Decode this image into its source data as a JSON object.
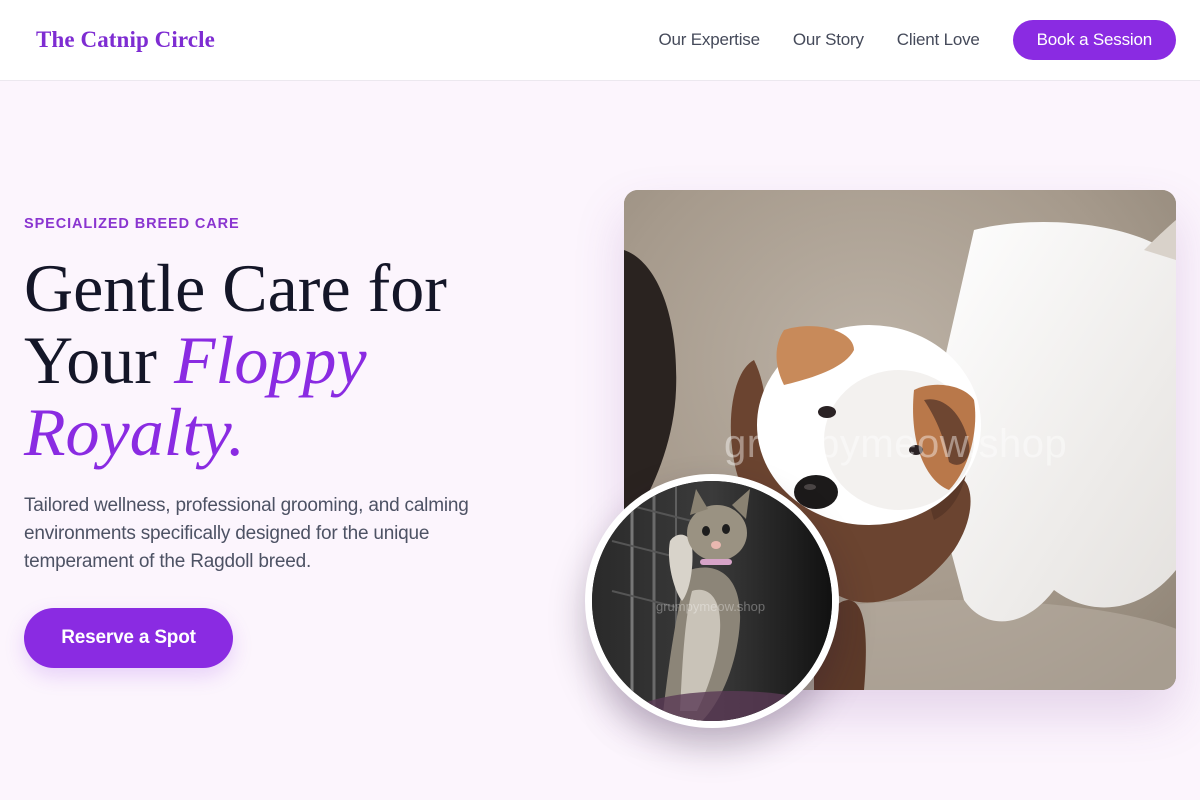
{
  "header": {
    "logo": "The Catnip Circle",
    "nav": [
      {
        "label": "Our Expertise"
      },
      {
        "label": "Our Story"
      },
      {
        "label": "Client Love"
      }
    ],
    "cta_label": "Book a Session"
  },
  "hero": {
    "eyebrow": "SPECIALIZED BREED CARE",
    "headline_plain": "Gentle Care for Your",
    "headline_accent": "Floppy Royalty.",
    "body": "Tailored wellness, professional grooming, and calming environments specifically designed for the unique temperament of the Ragdoll breed.",
    "button_label": "Reserve a Spot"
  },
  "images": {
    "main_watermark": "grumpymeow.shop",
    "inset_watermark": "grumpymeow.shop"
  },
  "colors": {
    "accent": "#8a2be2",
    "logo": "#7e2cd2",
    "page_bg": "#fcf5fd",
    "heading": "#141628",
    "body_text": "#4d5264"
  }
}
